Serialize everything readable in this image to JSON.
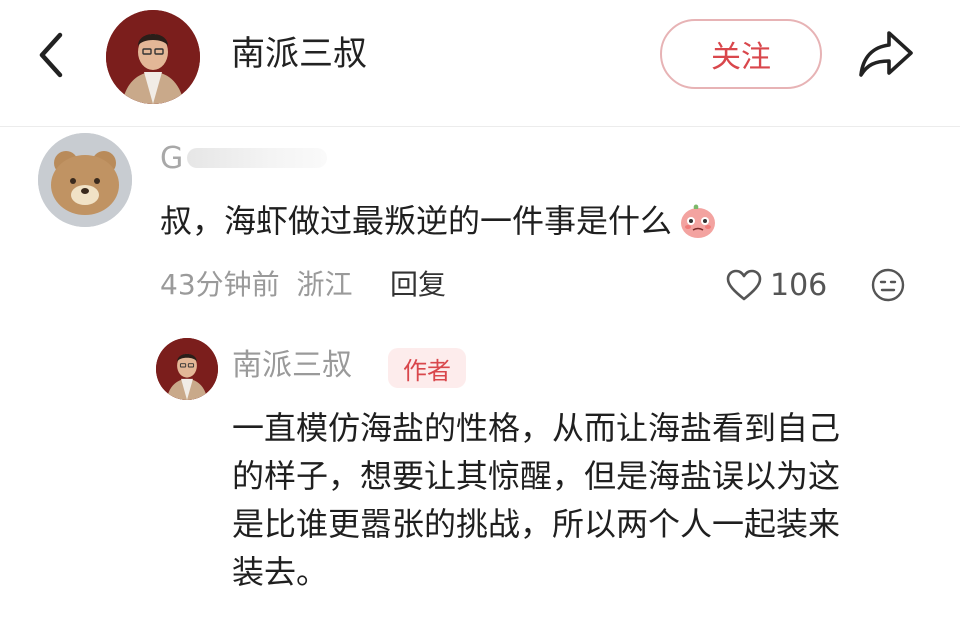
{
  "header": {
    "title": "南派三叔",
    "follow_label": "关注"
  },
  "comment": {
    "username": "G",
    "text": "叔，海虾做过最叛逆的一件事是什么",
    "time": "43分钟前",
    "location": "浙江",
    "reply_label": "回复",
    "likes": "106"
  },
  "reply": {
    "username": "南派三叔",
    "badge": "作者",
    "lines": [
      "一直模仿海盐的性格，从而让海盐看到自己",
      "的样子，想要让其惊醒，但是海盐误以为这",
      "是比谁更嚣张的挑战，所以两个人一起装来",
      "装去。"
    ]
  },
  "icons": {
    "back": "chevron-left-icon",
    "share": "share-arrow-icon",
    "like": "heart-outline-icon",
    "react": "emoji-face-icon",
    "emoji": "crying-peach-emoji-icon"
  },
  "colors": {
    "accent": "#d9474c",
    "follow_border": "#e7b3b5",
    "badge_bg": "#fdecec",
    "muted_text": "#9a9a9a"
  }
}
